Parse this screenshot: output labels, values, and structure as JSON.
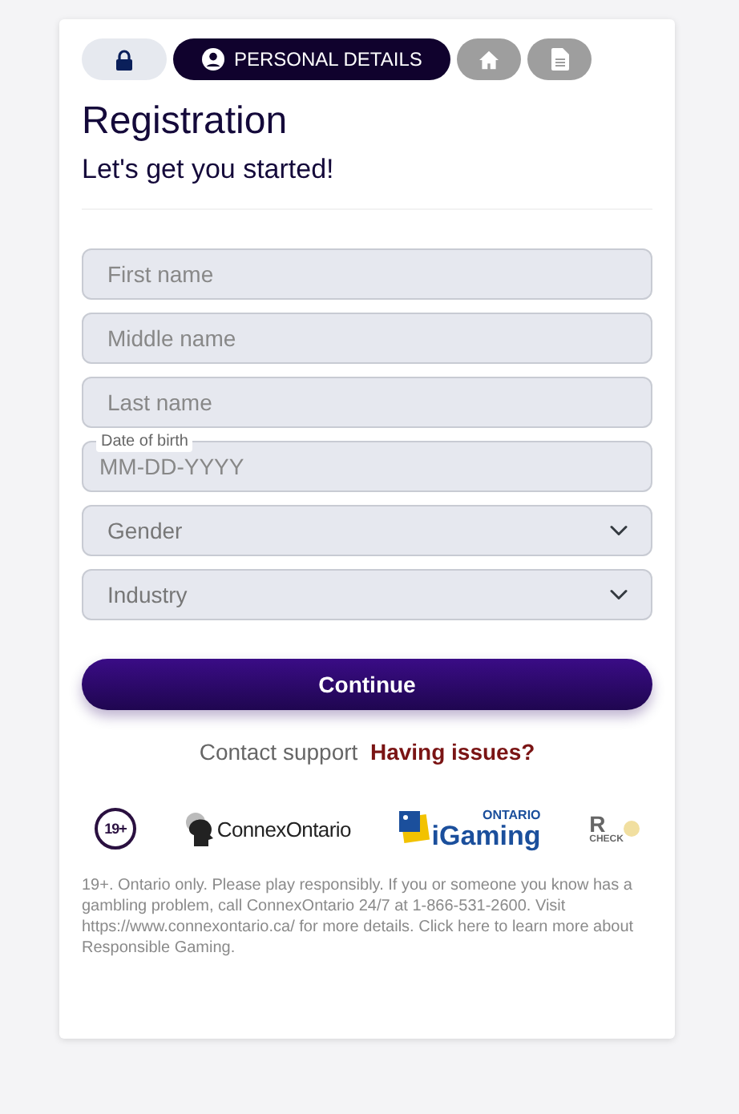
{
  "steps": [
    {
      "kind": "lock",
      "selected": false,
      "completed": true
    },
    {
      "kind": "user",
      "label": "PERSONAL DETAILS",
      "selected": true
    },
    {
      "kind": "home",
      "selected": false,
      "completed": false
    },
    {
      "kind": "document",
      "selected": false,
      "completed": false
    }
  ],
  "title": "Registration",
  "subtitle": "Let's get you started!",
  "fields": [
    {
      "kind": "text",
      "placeholder": "First name"
    },
    {
      "kind": "text",
      "placeholder": "Middle name"
    },
    {
      "kind": "text",
      "placeholder": "Last name"
    },
    {
      "kind": "date",
      "label": "Date of birth",
      "placeholder": "MM-DD-YYYY"
    },
    {
      "kind": "select",
      "value": "Gender"
    },
    {
      "kind": "select",
      "value": "Industry"
    }
  ],
  "continue_button": "Continue",
  "support": {
    "text": "Contact support",
    "link": "Having issues?"
  },
  "logos": [
    {
      "kind": "age",
      "text": "19+"
    },
    {
      "kind": "connex",
      "text": "ConnexOntario"
    },
    {
      "kind": "igaming",
      "text": "iGaming",
      "region": "ONTARIO"
    },
    {
      "kind": "rg",
      "text": "R",
      "sub": "CHECK"
    }
  ],
  "disclaimer": "19+. Ontario only. Please play responsibly. If you or someone you know has a gambling problem, call ConnexOntario 24/7 at 1-866-531-2600. Visit https://www.connexontario.ca/ for more details. Click here to learn more about Responsible Gaming."
}
